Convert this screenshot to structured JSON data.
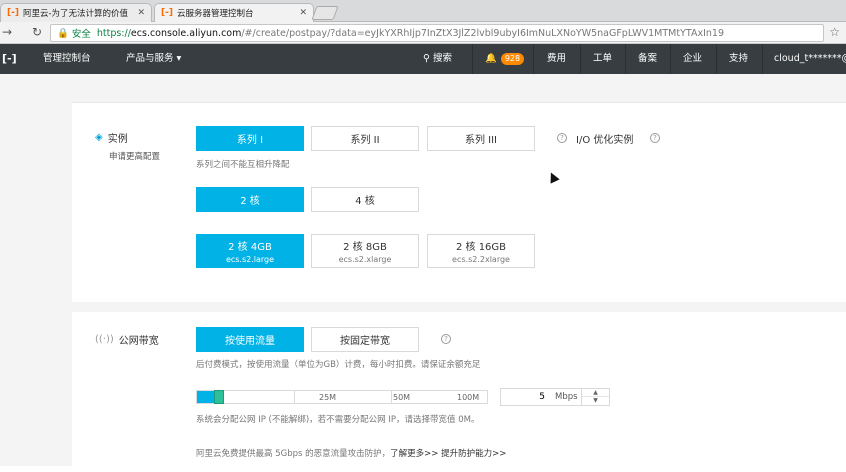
{
  "browser": {
    "tabs": [
      {
        "label": "阿里云-为了无法计算的价值",
        "active": false
      },
      {
        "label": "云服务器管理控制台",
        "active": true
      }
    ],
    "secure_label": "安全",
    "url_scheme": "https://",
    "url_host": "ecs.console.aliyun.com",
    "url_rest": "/#/create/postpay/?data=eyJkYXRhIjp7InZtX3JlZ2lvbl9ubyI6ImNuLXNoYW5naGFpLWV1MTMtYTAxIn19"
  },
  "header": {
    "brand": "[-]",
    "console": "管理控制台",
    "products": "产品与服务",
    "search": "搜索",
    "notifications_count": "928",
    "billing": "费用",
    "tickets": "工单",
    "filing": "备案",
    "enterprise": "企业",
    "support": "支持",
    "user": "cloud_t*******@ji"
  },
  "instance": {
    "label": "实例",
    "sublabel": "申请更高配置",
    "series": [
      "系列 I",
      "系列 II",
      "系列 III"
    ],
    "io_label": "I/O 优化实例",
    "series_note": "系列之间不能互相升降配",
    "cores": [
      "2 核",
      "4 核"
    ],
    "memory": [
      {
        "title": "2 核 4GB",
        "spec": "ecs.s2.large"
      },
      {
        "title": "2 核 8GB",
        "spec": "ecs.s2.xlarge"
      },
      {
        "title": "2 核 16GB",
        "spec": "ecs.s2.2xlarge"
      }
    ]
  },
  "bandwidth": {
    "label": "公网带宽",
    "options": [
      "按使用流量",
      "按固定带宽"
    ],
    "billing_note": "后付费模式，按使用流量（单位为GB）计费，每小时扣费。请保证余额充足",
    "ticks": [
      "25M",
      "50M",
      "100M"
    ],
    "slider_fraction": 0.05,
    "value": "5",
    "unit": "Mbps",
    "ip_note": "系统会分配公网 IP (不能解绑)，若不需要分配公网 IP，请选择带宽值 0M。",
    "ddos_note": "阿里云免费提供最高 5Gbps 的恶意流量攻击防护，",
    "ddos_link": "了解更多>>",
    "ddos_link2": "提升防护能力>>"
  },
  "colors": {
    "accent": "#00b2e5",
    "nav_bg": "#373d41",
    "badge": "#ff8a00"
  }
}
